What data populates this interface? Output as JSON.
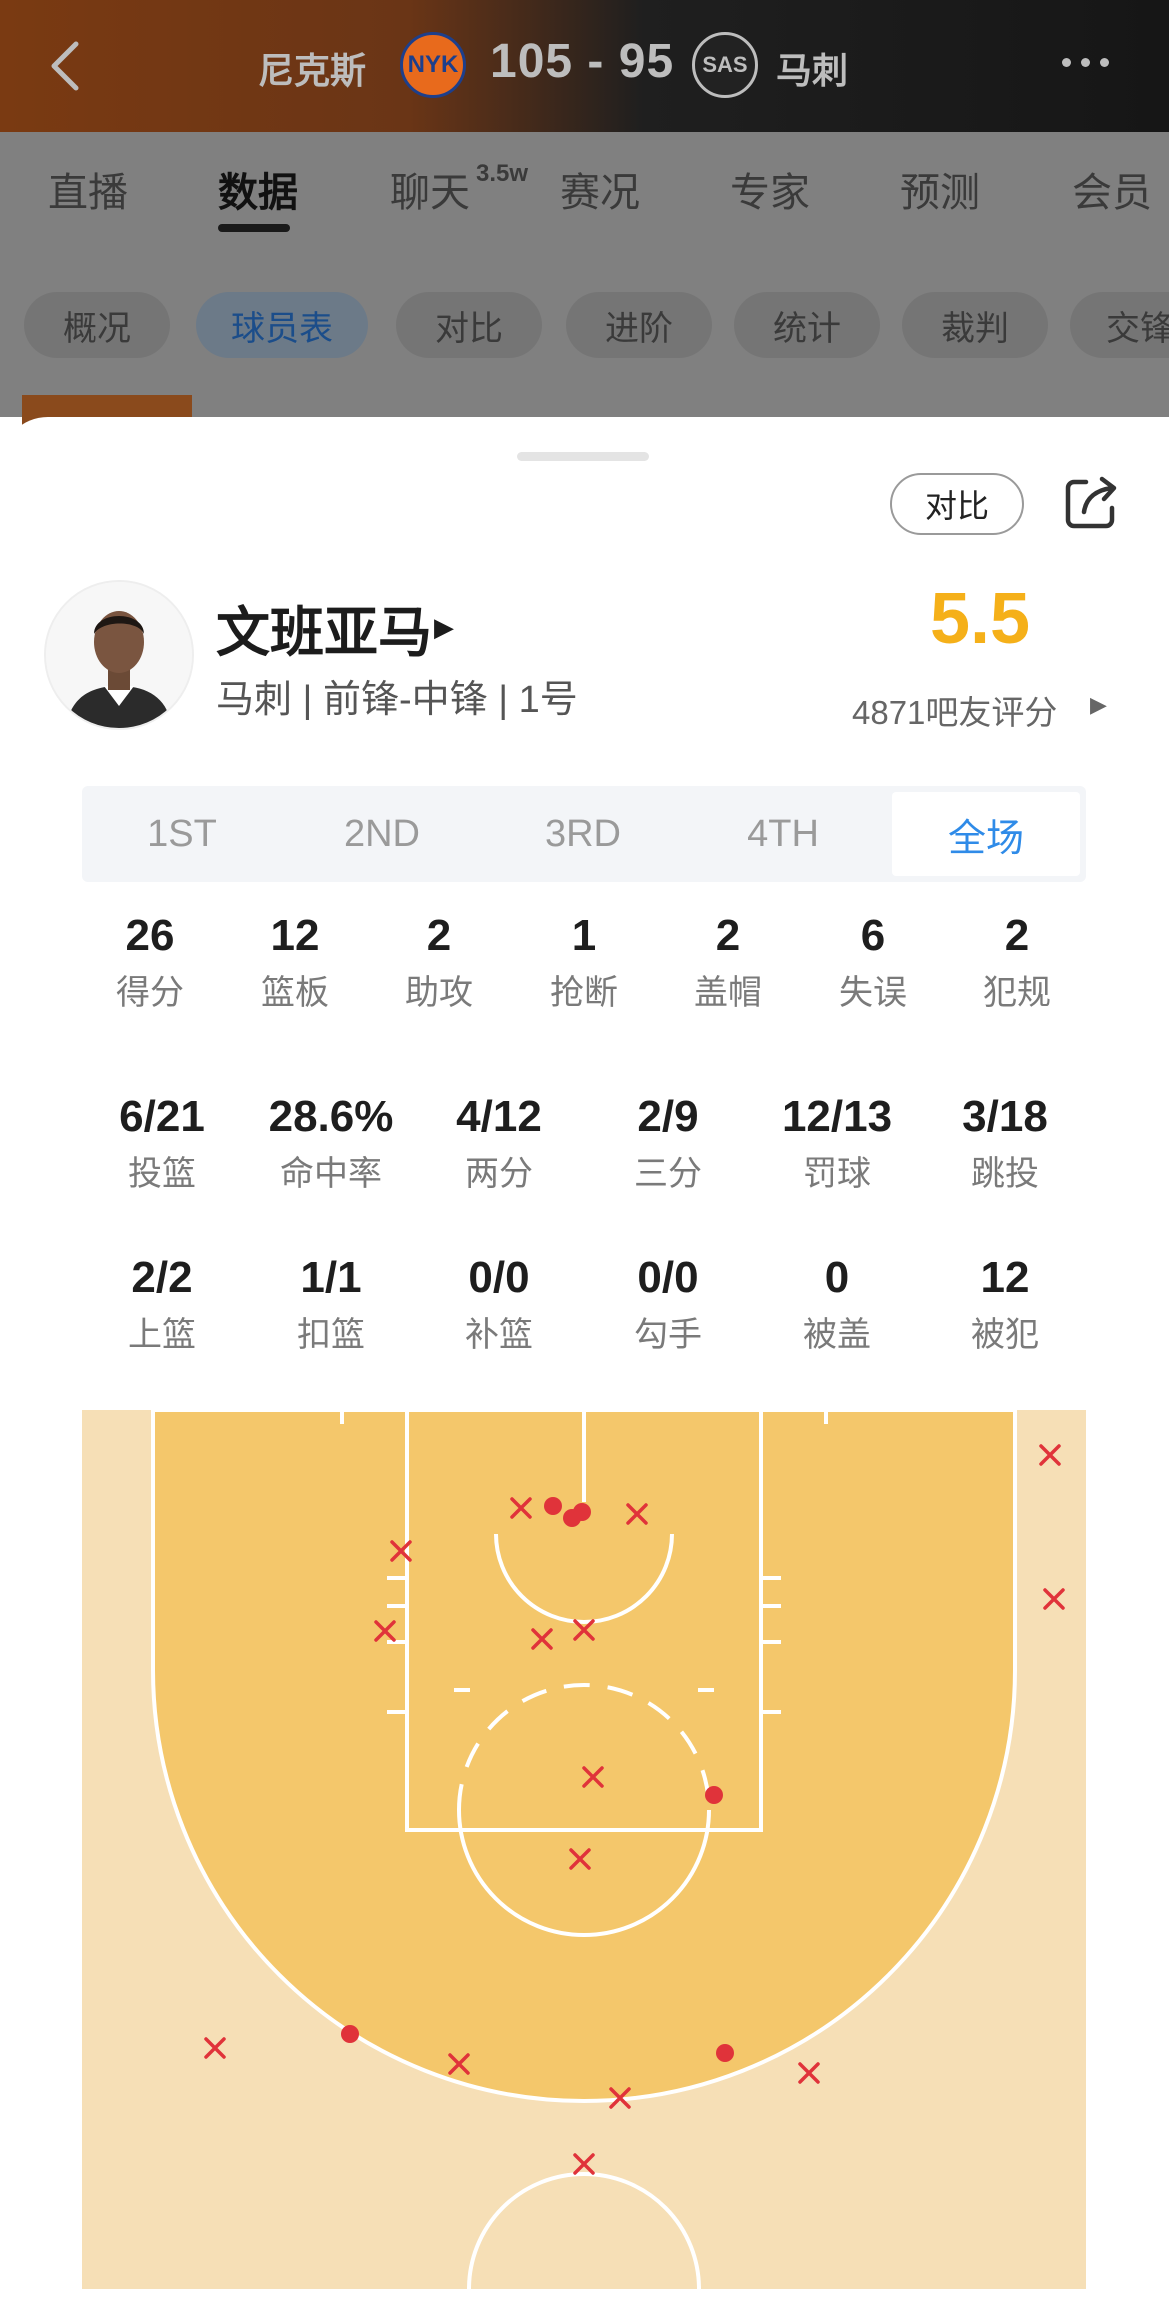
{
  "header": {
    "home_team": "尼克斯",
    "home_logo_text": "NYK",
    "score": "105 - 95",
    "away_logo_text": "SAS",
    "away_team": "马刺"
  },
  "tabs": [
    {
      "label": "直播"
    },
    {
      "label": "数据"
    },
    {
      "label": "聊天"
    },
    {
      "label": "赛况"
    },
    {
      "label": "专家"
    },
    {
      "label": "预测"
    },
    {
      "label": "会员"
    }
  ],
  "chat_badge": "3.5w",
  "subtabs": [
    {
      "label": "概况"
    },
    {
      "label": "球员表"
    },
    {
      "label": "对比"
    },
    {
      "label": "进阶"
    },
    {
      "label": "统计"
    },
    {
      "label": "裁判"
    },
    {
      "label": "交锋"
    }
  ],
  "player": {
    "compare_label": "对比",
    "name": "文班亚马",
    "subtitle": "马刺 | 前锋-中锋 | 1号",
    "rating": "5.5",
    "rating_count": "4871吧友评分"
  },
  "quarter_tabs": [
    {
      "label": "1ST"
    },
    {
      "label": "2ND"
    },
    {
      "label": "3RD"
    },
    {
      "label": "4TH"
    },
    {
      "label": "全场"
    }
  ],
  "stats_row1": [
    {
      "value": "26",
      "label": "得分"
    },
    {
      "value": "12",
      "label": "篮板"
    },
    {
      "value": "2",
      "label": "助攻"
    },
    {
      "value": "1",
      "label": "抢断"
    },
    {
      "value": "2",
      "label": "盖帽"
    },
    {
      "value": "6",
      "label": "失误"
    },
    {
      "value": "2",
      "label": "犯规"
    }
  ],
  "stats_row2": [
    {
      "value": "6/21",
      "label": "投篮"
    },
    {
      "value": "28.6%",
      "label": "命中率"
    },
    {
      "value": "4/12",
      "label": "两分"
    },
    {
      "value": "2/9",
      "label": "三分"
    },
    {
      "value": "12/13",
      "label": "罚球"
    },
    {
      "value": "3/18",
      "label": "跳投"
    }
  ],
  "stats_row3": [
    {
      "value": "2/2",
      "label": "上篮"
    },
    {
      "value": "1/1",
      "label": "扣篮"
    },
    {
      "value": "0/0",
      "label": "补篮"
    },
    {
      "value": "0/0",
      "label": "勾手"
    },
    {
      "value": "0",
      "label": "被盖"
    },
    {
      "value": "12",
      "label": "被犯"
    }
  ],
  "colors": {
    "rating": "#f5b019",
    "active_tab": "#2f8be8",
    "shot_mark": "#e0333a",
    "paint": "#f4c76b",
    "court_outer": "#f6dfb6"
  }
}
